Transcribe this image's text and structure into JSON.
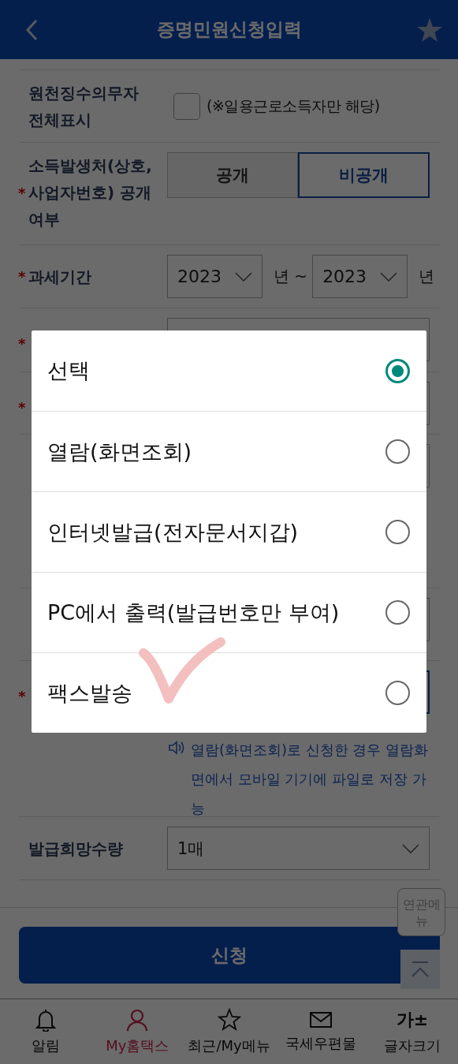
{
  "header": {
    "title": "증명민원신청입력"
  },
  "form": {
    "withholding": {
      "label": "원천징수의무자 전체표시",
      "checked": false,
      "note": "(※일용근로소득자만 해당)"
    },
    "disclosure": {
      "mark": "*",
      "label": "소득발생처(상호, 사업자번호) 공개여부",
      "options": [
        {
          "label": "공개",
          "selected": false
        },
        {
          "label": "비공개",
          "selected": true
        }
      ]
    },
    "period": {
      "mark": "*",
      "label": "과세기간",
      "from": "2023",
      "from_unit": "년 ~",
      "to": "2023",
      "to_unit": "년"
    },
    "hidden_rows": [
      {
        "mark": "*"
      },
      {
        "mark": "*"
      },
      {},
      {},
      {
        "mark": "*",
        "hint": "열람(화면조회)로 신청한 경우 열람화면에서 모바일 기기에 파일로 저장 가능"
      }
    ],
    "quantity": {
      "label": "발급희망수량",
      "value": "1매"
    }
  },
  "submit": "신청",
  "floating": {
    "related_menu": "연관메뉴"
  },
  "nav": [
    {
      "label": "알림",
      "kind": "bell",
      "selected": false
    },
    {
      "label": "My홈택스",
      "kind": "person",
      "selected": true
    },
    {
      "label": "최근/My메뉴",
      "kind": "star",
      "selected": false
    },
    {
      "label": "국세우편물",
      "kind": "mail",
      "selected": false
    },
    {
      "label": "글자크기",
      "kind": "text",
      "glyph": "가±",
      "selected": false
    }
  ],
  "dialog": {
    "options": [
      {
        "label": "선택",
        "selected": true
      },
      {
        "label": "열람(화면조회)",
        "selected": false
      },
      {
        "label": "인터넷발급(전자문서지갑)",
        "selected": false
      },
      {
        "label": "PC에서 출력(발급번호만 부여)",
        "selected": false
      },
      {
        "label": "팩스발송",
        "selected": false
      }
    ]
  }
}
